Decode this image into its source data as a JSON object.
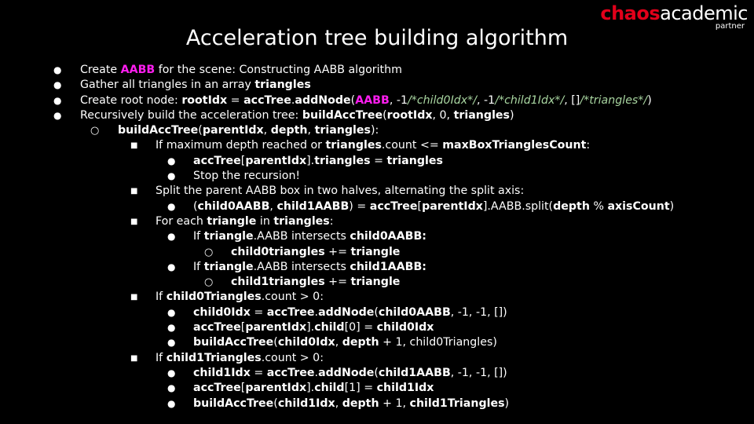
{
  "logo": {
    "chaos": "chaos",
    "academic": "academic",
    "partner": "partner"
  },
  "title": "Acceleration tree building algorithm",
  "bullets": {
    "disc": "●",
    "circle": "○",
    "square": "■"
  },
  "lines": [
    {
      "level": 1,
      "bullet": "●",
      "runs": [
        {
          "t": "Create "
        },
        {
          "t": "AABB",
          "s": "m"
        },
        {
          "t": " for the scene: Constructing AABB algorithm"
        }
      ]
    },
    {
      "level": 1,
      "bullet": "●",
      "runs": [
        {
          "t": "Gather all triangles in an array "
        },
        {
          "t": "triangles",
          "s": "b"
        }
      ]
    },
    {
      "level": 1,
      "bullet": "●",
      "runs": [
        {
          "t": "Create root node: "
        },
        {
          "t": "rootIdx",
          "s": "b"
        },
        {
          "t": " = "
        },
        {
          "t": "accTree",
          "s": "b"
        },
        {
          "t": "."
        },
        {
          "t": "addNode",
          "s": "b"
        },
        {
          "t": "("
        },
        {
          "t": "AABB",
          "s": "m"
        },
        {
          "t": ", -1"
        },
        {
          "t": "/*child0Idx*/",
          "s": "c"
        },
        {
          "t": ", -1"
        },
        {
          "t": "/*child1Idx*/",
          "s": "c"
        },
        {
          "t": ", []"
        },
        {
          "t": "/*triangles*/",
          "s": "c"
        },
        {
          "t": ")"
        }
      ]
    },
    {
      "level": 1,
      "bullet": "●",
      "runs": [
        {
          "t": "Recursively build the acceleration tree: "
        },
        {
          "t": "buildAccTree",
          "s": "b"
        },
        {
          "t": "("
        },
        {
          "t": "rootIdx",
          "s": "b"
        },
        {
          "t": ", 0, "
        },
        {
          "t": "triangles",
          "s": "b"
        },
        {
          "t": ")"
        }
      ]
    },
    {
      "level": 2,
      "bullet": "○",
      "runs": [
        {
          "t": "buildAccTree",
          "s": "b"
        },
        {
          "t": "("
        },
        {
          "t": "parentIdx",
          "s": "b"
        },
        {
          "t": ", "
        },
        {
          "t": "depth",
          "s": "b"
        },
        {
          "t": ", "
        },
        {
          "t": "triangles",
          "s": "b"
        },
        {
          "t": "):"
        }
      ]
    },
    {
      "level": 3,
      "bullet": "■",
      "runs": [
        {
          "t": "If maximum depth reached or "
        },
        {
          "t": "triangles",
          "s": "b"
        },
        {
          "t": ".count <= "
        },
        {
          "t": "maxBoxTrianglesCount",
          "s": "b"
        },
        {
          "t": ":"
        }
      ]
    },
    {
      "level": 4,
      "bullet": "●",
      "runs": [
        {
          "t": "accTree",
          "s": "b"
        },
        {
          "t": "["
        },
        {
          "t": "parentIdx",
          "s": "b"
        },
        {
          "t": "]."
        },
        {
          "t": "triangles",
          "s": "b"
        },
        {
          "t": " = "
        },
        {
          "t": "triangles",
          "s": "b"
        }
      ]
    },
    {
      "level": 4,
      "bullet": "●",
      "runs": [
        {
          "t": "Stop the recursion!"
        }
      ]
    },
    {
      "level": 3,
      "bullet": "■",
      "runs": [
        {
          "t": "Split the parent AABB box in two halves, alternating the split axis:"
        }
      ]
    },
    {
      "level": 4,
      "bullet": "●",
      "runs": [
        {
          "t": "("
        },
        {
          "t": "child0AABB",
          "s": "b"
        },
        {
          "t": ", "
        },
        {
          "t": "child1AABB",
          "s": "b"
        },
        {
          "t": ") = "
        },
        {
          "t": "accTree",
          "s": "b"
        },
        {
          "t": "["
        },
        {
          "t": "parentIdx",
          "s": "b"
        },
        {
          "t": "].AABB.split("
        },
        {
          "t": "depth",
          "s": "b"
        },
        {
          "t": " % "
        },
        {
          "t": "axisCount",
          "s": "b"
        },
        {
          "t": ")"
        }
      ]
    },
    {
      "level": 3,
      "bullet": "■",
      "runs": [
        {
          "t": "For each "
        },
        {
          "t": "triangle",
          "s": "b"
        },
        {
          "t": " in "
        },
        {
          "t": "triangles",
          "s": "b"
        },
        {
          "t": ":"
        }
      ]
    },
    {
      "level": 4,
      "bullet": "●",
      "runs": [
        {
          "t": "If "
        },
        {
          "t": "triangle",
          "s": "b"
        },
        {
          "t": ".AABB intersects "
        },
        {
          "t": "child0AABB:",
          "s": "b"
        }
      ]
    },
    {
      "level": 5,
      "bullet": "○",
      "runs": [
        {
          "t": "child0triangles",
          "s": "b"
        },
        {
          "t": " += "
        },
        {
          "t": "triangle",
          "s": "b"
        }
      ]
    },
    {
      "level": 4,
      "bullet": "●",
      "runs": [
        {
          "t": "If "
        },
        {
          "t": "triangle",
          "s": "b"
        },
        {
          "t": ".AABB intersects "
        },
        {
          "t": "child1AABB:",
          "s": "b"
        }
      ]
    },
    {
      "level": 5,
      "bullet": "○",
      "runs": [
        {
          "t": "child1triangles",
          "s": "b"
        },
        {
          "t": " += "
        },
        {
          "t": "triangle",
          "s": "b"
        }
      ]
    },
    {
      "level": 3,
      "bullet": "■",
      "runs": [
        {
          "t": "If "
        },
        {
          "t": "child0Triangles",
          "s": "b"
        },
        {
          "t": ".count > 0:"
        }
      ]
    },
    {
      "level": 4,
      "bullet": "●",
      "runs": [
        {
          "t": "child0Idx",
          "s": "b"
        },
        {
          "t": " = "
        },
        {
          "t": "accTree",
          "s": "b"
        },
        {
          "t": "."
        },
        {
          "t": "addNode",
          "s": "b"
        },
        {
          "t": "("
        },
        {
          "t": "child0AABB",
          "s": "b"
        },
        {
          "t": ", -1, -1, [])"
        }
      ]
    },
    {
      "level": 4,
      "bullet": "●",
      "runs": [
        {
          "t": "accTree",
          "s": "b"
        },
        {
          "t": "["
        },
        {
          "t": "parentIdx",
          "s": "b"
        },
        {
          "t": "]."
        },
        {
          "t": "child",
          "s": "b"
        },
        {
          "t": "[0] = "
        },
        {
          "t": "child0Idx",
          "s": "b"
        }
      ]
    },
    {
      "level": 4,
      "bullet": "●",
      "runs": [
        {
          "t": "buildAccTree",
          "s": "b"
        },
        {
          "t": "("
        },
        {
          "t": "child0Idx",
          "s": "b"
        },
        {
          "t": ", "
        },
        {
          "t": "depth",
          "s": "b"
        },
        {
          "t": " + 1, child0Triangles)"
        }
      ]
    },
    {
      "level": 3,
      "bullet": "■",
      "runs": [
        {
          "t": "If "
        },
        {
          "t": "child1Triangles",
          "s": "b"
        },
        {
          "t": ".count > 0:"
        }
      ]
    },
    {
      "level": 4,
      "bullet": "●",
      "runs": [
        {
          "t": "child1Idx",
          "s": "b"
        },
        {
          "t": " = "
        },
        {
          "t": "accTree",
          "s": "b"
        },
        {
          "t": "."
        },
        {
          "t": "addNode",
          "s": "b"
        },
        {
          "t": "("
        },
        {
          "t": "child1AABB",
          "s": "b"
        },
        {
          "t": ", -1, -1, [])"
        }
      ]
    },
    {
      "level": 4,
      "bullet": "●",
      "runs": [
        {
          "t": "accTree",
          "s": "b"
        },
        {
          "t": "["
        },
        {
          "t": "parentIdx",
          "s": "b"
        },
        {
          "t": "]."
        },
        {
          "t": "child",
          "s": "b"
        },
        {
          "t": "[1] = "
        },
        {
          "t": "child1Idx",
          "s": "b"
        }
      ]
    },
    {
      "level": 4,
      "bullet": "●",
      "runs": [
        {
          "t": "buildAccTree",
          "s": "b"
        },
        {
          "t": "("
        },
        {
          "t": "child1Idx",
          "s": "b"
        },
        {
          "t": ", "
        },
        {
          "t": "depth",
          "s": "b"
        },
        {
          "t": " + 1, "
        },
        {
          "t": "child1Triangles",
          "s": "b"
        },
        {
          "t": ")"
        }
      ]
    }
  ],
  "colors": {
    "background": "#000000",
    "text": "#ffffff",
    "brand_red": "#e2001a",
    "highlight_magenta": "#ff1ef0",
    "comment_green": "#a8d5a0"
  }
}
